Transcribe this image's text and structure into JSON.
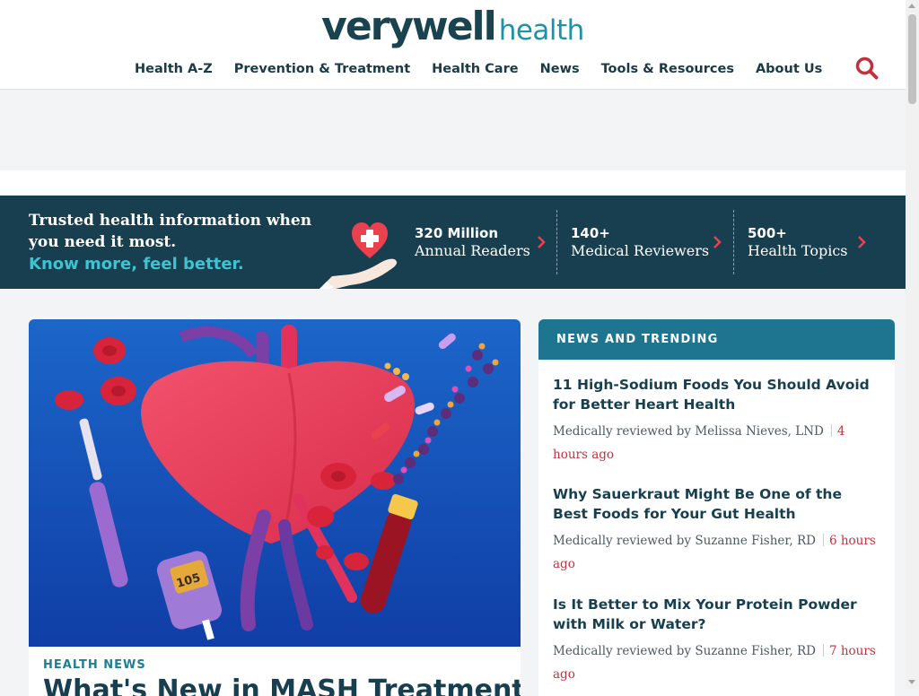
{
  "logo": {
    "part1": "verywell",
    "part2": "health"
  },
  "nav": {
    "items": [
      {
        "label": "Health A-Z"
      },
      {
        "label": "Prevention & Treatment"
      },
      {
        "label": "Health Care"
      },
      {
        "label": "News"
      },
      {
        "label": "Tools & Resources"
      },
      {
        "label": "About Us"
      }
    ],
    "search_icon": "search-icon"
  },
  "ribbon": {
    "line1": "Trusted health information when",
    "line2": "you need it most.",
    "tagline": "Know more, feel better.",
    "illustration": "heart-in-hand-icon",
    "stats": [
      {
        "number": "320 Million",
        "label": "Annual Readers"
      },
      {
        "number": "140+",
        "label": "Medical Reviewers"
      },
      {
        "number": "500+",
        "label": "Health Topics"
      }
    ]
  },
  "feature": {
    "kicker": "HEALTH NEWS",
    "title": "What's New in MASH Treatment?",
    "glucometer_reading": "105"
  },
  "trending": {
    "heading": "NEWS AND TRENDING",
    "items": [
      {
        "title": "11 High-Sodium Foods You Should Avoid for Better Heart Health",
        "reviewer": "Medically reviewed by Melissa Nieves, LND",
        "time": "4 hours ago"
      },
      {
        "title": "Why Sauerkraut Might Be One of the Best Foods for Your Gut Health",
        "reviewer": "Medically reviewed by Suzanne Fisher, RD",
        "time": "6 hours ago"
      },
      {
        "title": "Is It Better to Mix Your Protein Powder with Milk or Water?",
        "reviewer": "Medically reviewed by Suzanne Fisher, RD",
        "time": "7 hours ago"
      }
    ]
  },
  "colors": {
    "brand_dark": "#173f4f",
    "brand_teal": "#1e7590",
    "accent_red": "#c2323c",
    "tagline_cyan": "#3fc2d2"
  }
}
